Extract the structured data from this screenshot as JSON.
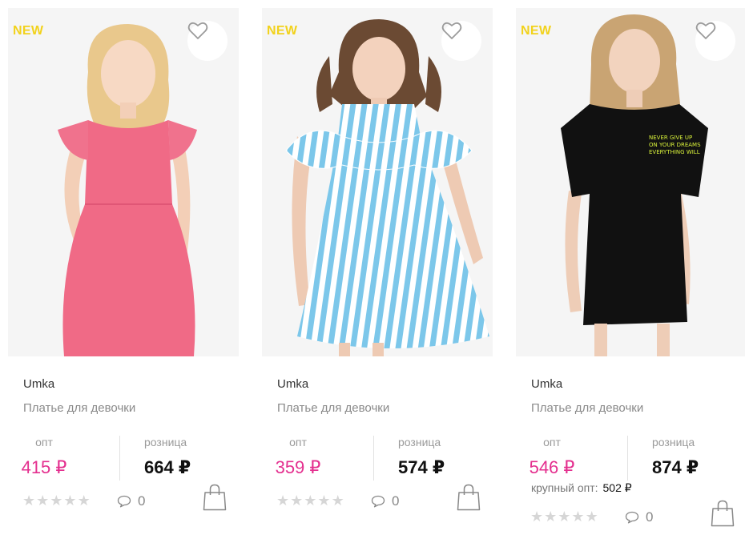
{
  "products": [
    {
      "badge": "NEW",
      "brand": "Umka",
      "title": "Платье для девочки",
      "opt_label": "опт",
      "opt_price": "415 ₽",
      "retail_label": "розница",
      "retail_price": "664 ₽",
      "rating_stars": 0,
      "comments": "0",
      "dress_color": "#f06a86"
    },
    {
      "badge": "NEW",
      "brand": "Umka",
      "title": "Платье для девочки",
      "opt_label": "опт",
      "opt_price": "359 ₽",
      "retail_label": "розница",
      "retail_price": "574 ₽",
      "rating_stars": 0,
      "comments": "0",
      "dress_color": "#7cc7ea"
    },
    {
      "badge": "NEW",
      "brand": "Umka",
      "title": "Платье для девочки",
      "opt_label": "опт",
      "opt_price": "546 ₽",
      "retail_label": "розница",
      "retail_price": "874 ₽",
      "wholesale_label": "крупный опт:",
      "wholesale_price": "502 ₽",
      "rating_stars": 0,
      "comments": "0",
      "dress_color": "#111111"
    }
  ],
  "colors": {
    "badge": "#f2d21c",
    "opt_price": "#e4308f",
    "retail_price": "#111111",
    "star_empty": "#d6d6d6"
  },
  "icons": {
    "favorite": "heart-outline-icon",
    "comments": "speech-bubble-icon",
    "cart": "shopping-bag-icon",
    "rating": "star-icon"
  }
}
